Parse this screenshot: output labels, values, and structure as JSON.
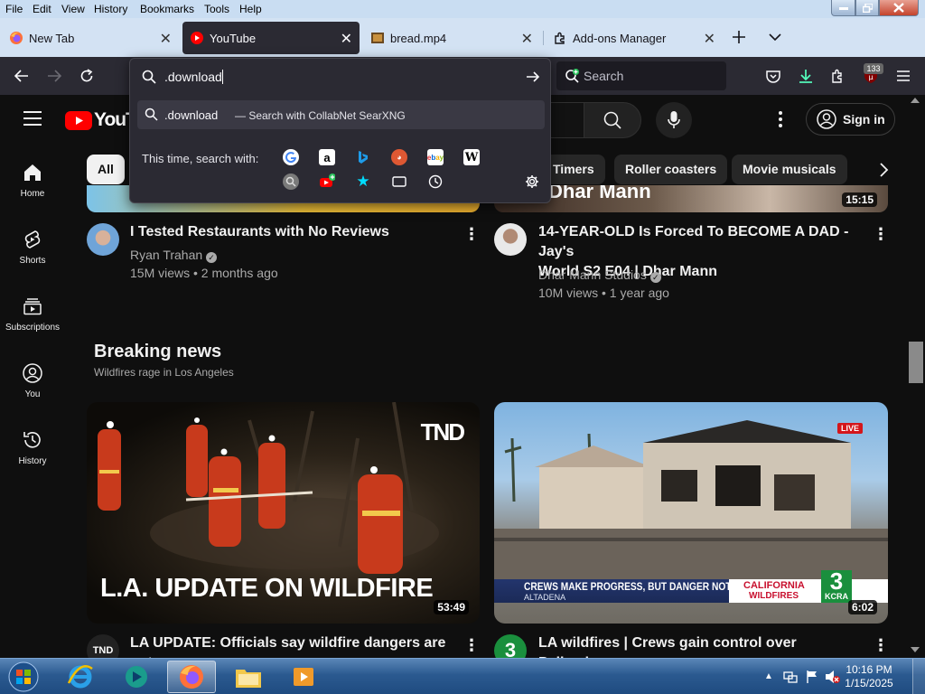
{
  "menubar": {
    "items": [
      "File",
      "Edit",
      "View",
      "History",
      "Bookmarks",
      "Tools",
      "Help"
    ],
    "accel": [
      "F",
      "E",
      "V",
      "H",
      "B",
      "T",
      "H"
    ]
  },
  "tabs": [
    {
      "title": "New Tab",
      "icon": "firefox-icon"
    },
    {
      "title": "YouTube",
      "icon": "youtube-icon",
      "active": true
    },
    {
      "title": "bread.mp4",
      "icon": "video-file-icon"
    },
    {
      "title": "Add-ons Manager",
      "icon": "puzzle-icon"
    }
  ],
  "urlbar": {
    "value": ".download",
    "suggestion_query": ".download",
    "suggestion_suffix": "— Search with CollabNet SearXNG",
    "one_time_label": "This time, search with:",
    "engines_row1": [
      "google",
      "amazon",
      "bing",
      "duckduckgo",
      "ebay",
      "wikipedia"
    ],
    "engines_row2": [
      "searxng",
      "youtube",
      "bookmarks",
      "tabs",
      "history",
      "settings"
    ]
  },
  "ff_search": {
    "placeholder": "Search"
  },
  "toolbar": {
    "badge_count": "133"
  },
  "youtube": {
    "logo_text": "YouTube",
    "sign_in": "Sign in",
    "nav": [
      {
        "label": "Home",
        "icon": "home-icon"
      },
      {
        "label": "Shorts",
        "icon": "shorts-icon"
      },
      {
        "label": "Subscriptions",
        "icon": "subscriptions-icon"
      },
      {
        "label": "You",
        "icon": "you-icon"
      },
      {
        "label": "History",
        "icon": "history-icon"
      }
    ],
    "chips": [
      "All",
      "Timers",
      "Roller coasters",
      "Movie musicals"
    ],
    "top_partial": {
      "left_text": "",
      "right_text": "Dhar Mann",
      "right_duration": "15:15"
    },
    "videos_top": [
      {
        "title": "I Tested Restaurants with No Reviews",
        "channel": "Ryan Trahan",
        "meta": "15M views • 2 months ago"
      },
      {
        "title_line1": "14-YEAR-OLD Is Forced To BECOME A DAD - Jay's",
        "title_line2": "World S2 E04 | Dhar Mann",
        "channel": "Dhar Mann Studios",
        "meta": "10M views • 1 year ago"
      }
    ],
    "breaking": {
      "title": "Breaking news",
      "subtitle": "Wildfires rage in Los Angeles"
    },
    "videos_news": [
      {
        "title": "LA UPDATE: Officials say wildfire dangers are not",
        "duration": "53:49",
        "banner": "L.A. UPDATE ON WILDFIRE",
        "brand": "TND"
      },
      {
        "title": "LA wildfires | Crews gain control over Palisades,",
        "duration": "6:02",
        "lower_third": "CREWS MAKE PROGRESS, BUT DANGER NOT OVER",
        "location": "ALTADENA",
        "tag1": "CALIFORNIA",
        "tag2": "WILDFIRES",
        "station_num": "3",
        "station": "KCRA",
        "live": "LIVE"
      }
    ]
  },
  "taskbar": {
    "time": "10:16 PM",
    "date": "1/15/2025"
  }
}
